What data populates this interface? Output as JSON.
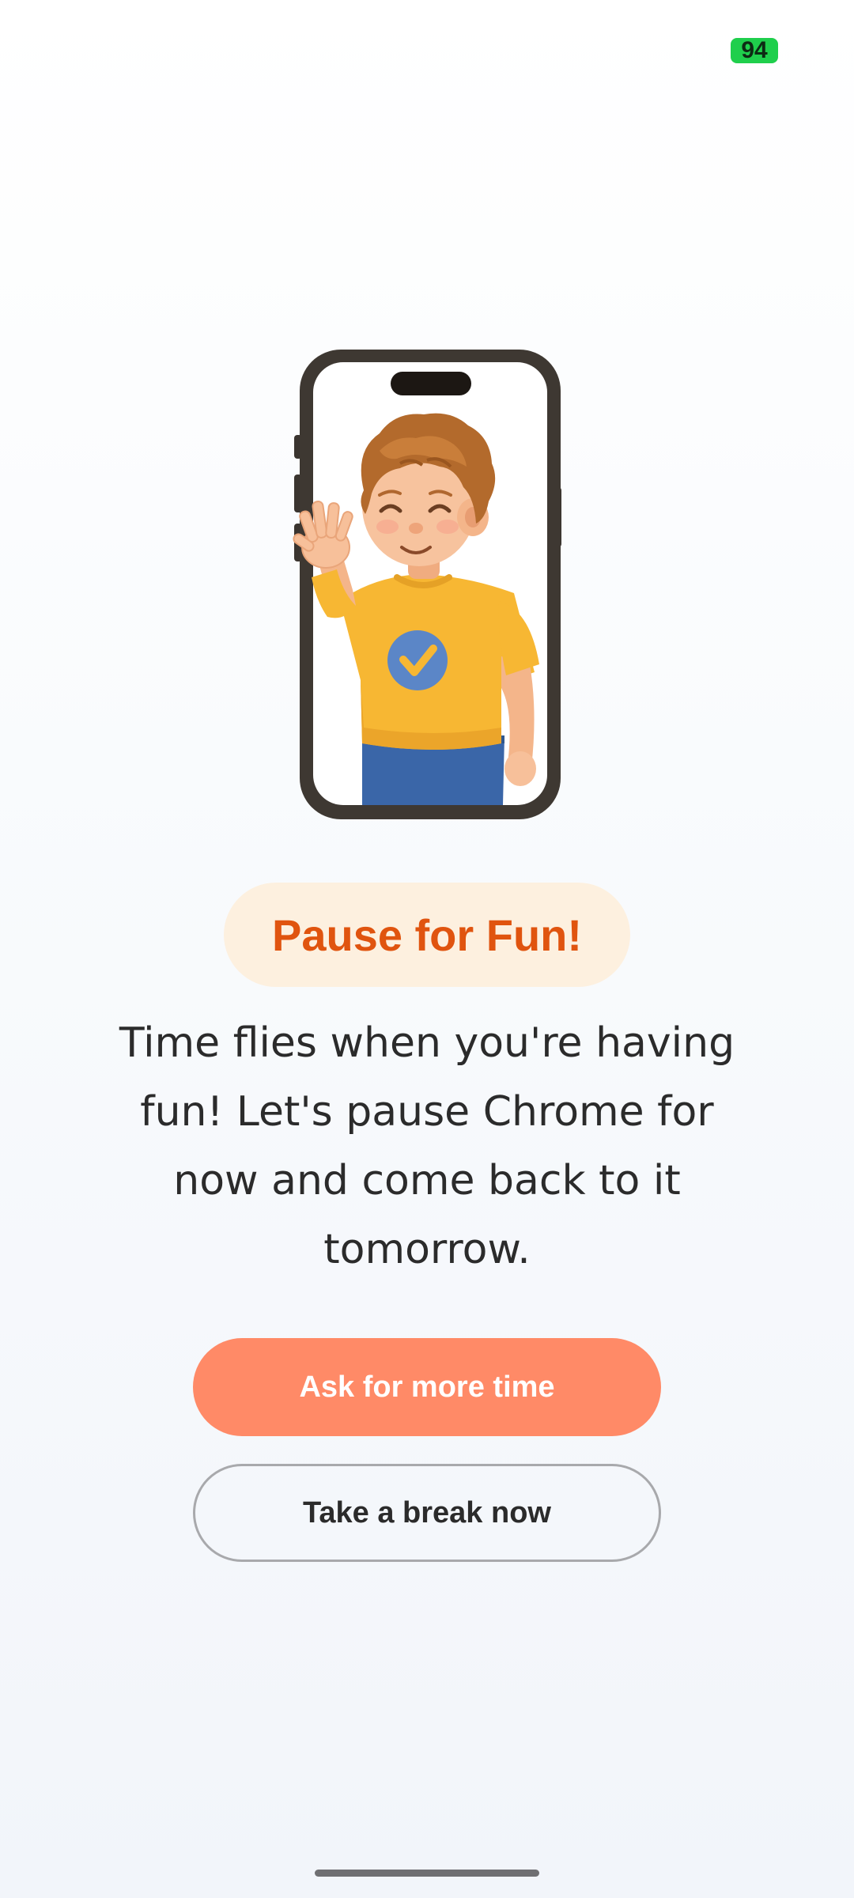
{
  "status_bar": {
    "battery_level": "94",
    "battery_color": "#1fcf4c"
  },
  "illustration": {
    "icon": "phone-waving-child-illustration"
  },
  "title": {
    "text": "Pause for Fun!",
    "color": "#e0540f",
    "pill_color": "#fdf0df"
  },
  "message": {
    "text": "Time flies when you're having fun! Let's pause Chrome for now and come back to it tomorrow."
  },
  "actions": {
    "primary_label": "Ask for more time",
    "primary_color": "#ff8a67",
    "secondary_label": "Take a break now"
  }
}
